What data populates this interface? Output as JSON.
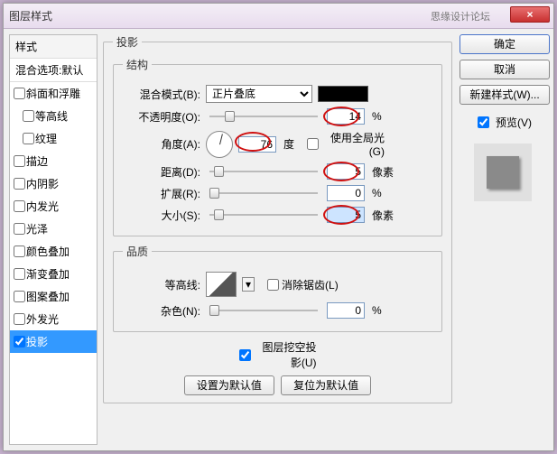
{
  "window": {
    "title": "图层样式",
    "credit": "思缘设计论坛",
    "close": "×"
  },
  "sidebar": {
    "header": "样式",
    "sub": "混合选项:默认",
    "items": [
      {
        "label": "斜面和浮雕",
        "checked": false,
        "indent": false
      },
      {
        "label": "等高线",
        "checked": false,
        "indent": true
      },
      {
        "label": "纹理",
        "checked": false,
        "indent": true
      },
      {
        "label": "描边",
        "checked": false,
        "indent": false
      },
      {
        "label": "内阴影",
        "checked": false,
        "indent": false
      },
      {
        "label": "内发光",
        "checked": false,
        "indent": false
      },
      {
        "label": "光泽",
        "checked": false,
        "indent": false
      },
      {
        "label": "颜色叠加",
        "checked": false,
        "indent": false
      },
      {
        "label": "渐变叠加",
        "checked": false,
        "indent": false
      },
      {
        "label": "图案叠加",
        "checked": false,
        "indent": false
      },
      {
        "label": "外发光",
        "checked": false,
        "indent": false
      },
      {
        "label": "投影",
        "checked": true,
        "indent": false,
        "active": true
      }
    ]
  },
  "panel": {
    "title": "投影",
    "structure": {
      "legend": "结构",
      "blendMode": {
        "label": "混合模式(B):",
        "value": "正片叠底"
      },
      "opacity": {
        "label": "不透明度(O):",
        "value": "14",
        "unit": "%",
        "pos": 14
      },
      "angle": {
        "label": "角度(A):",
        "value": "76",
        "unit": "度",
        "globalLabel": "使用全局光(G)",
        "globalChecked": false
      },
      "distance": {
        "label": "距离(D):",
        "value": "5",
        "unit": "像素",
        "pos": 4
      },
      "spread": {
        "label": "扩展(R):",
        "value": "0",
        "unit": "%",
        "pos": 0
      },
      "size": {
        "label": "大小(S):",
        "value": "5",
        "unit": "像素",
        "pos": 4
      }
    },
    "quality": {
      "legend": "品质",
      "contour": {
        "label": "等高线:",
        "antiAliasLabel": "消除锯齿(L)",
        "antiAliasChecked": false
      },
      "noise": {
        "label": "杂色(N):",
        "value": "0",
        "unit": "%",
        "pos": 0
      }
    },
    "knockout": {
      "label": "图层挖空投影(U)",
      "checked": true
    },
    "buttons": {
      "setDefault": "设置为默认值",
      "resetDefault": "复位为默认值"
    }
  },
  "right": {
    "ok": "确定",
    "cancel": "取消",
    "newStyle": "新建样式(W)...",
    "previewLabel": "预览(V)",
    "previewChecked": true
  }
}
